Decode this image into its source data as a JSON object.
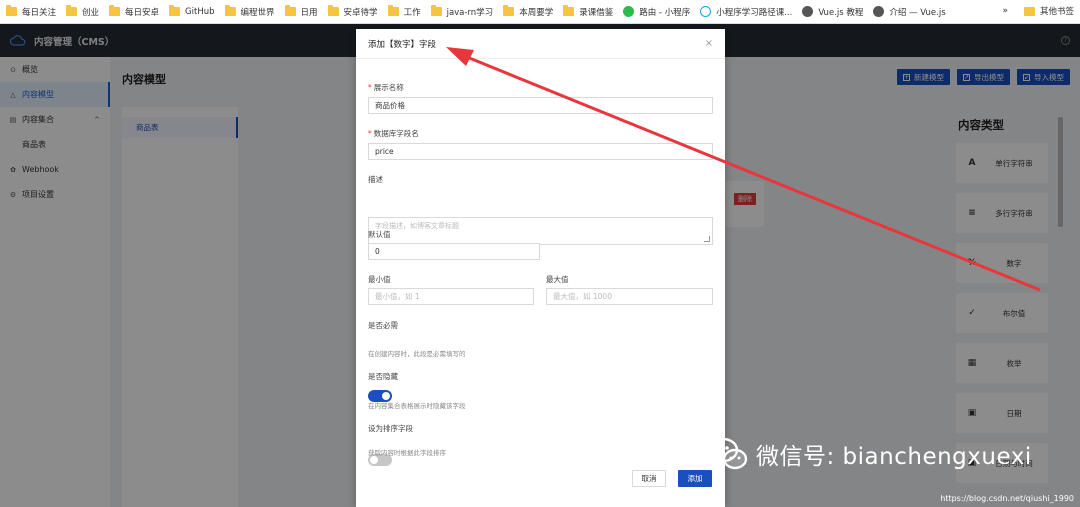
{
  "bookmarks": [
    {
      "label": "每日关注",
      "icon": "folder-icon"
    },
    {
      "label": "创业",
      "icon": "folder-icon"
    },
    {
      "label": "每日安卓",
      "icon": "folder-icon"
    },
    {
      "label": "GitHub",
      "icon": "folder-icon"
    },
    {
      "label": "编程世界",
      "icon": "folder-icon"
    },
    {
      "label": "日用",
      "icon": "folder-icon"
    },
    {
      "label": "安卓待学",
      "icon": "folder-icon"
    },
    {
      "label": "工作",
      "icon": "folder-icon"
    },
    {
      "label": "java-rn学习",
      "icon": "folder-icon"
    },
    {
      "label": "本周要学",
      "icon": "folder-icon"
    },
    {
      "label": "录课借鉴",
      "icon": "folder-icon"
    },
    {
      "label": "路由 - 小程序",
      "icon": "wechat-icon"
    },
    {
      "label": "小程序学习路径课...",
      "icon": "cloud-icon"
    },
    {
      "label": "Vue.js 教程",
      "icon": "globe-icon"
    },
    {
      "label": "介绍 — Vue.js",
      "icon": "globe-icon"
    }
  ],
  "bookmarks_more": "»",
  "bookmarks_other": "其他书签",
  "app": {
    "title": "内容管理（CMS）",
    "help": "?"
  },
  "sidebar": {
    "items": [
      {
        "label": "概览",
        "icon": "⊙"
      },
      {
        "label": "内容模型",
        "icon": "△"
      },
      {
        "label": "内容集合",
        "icon": "▤",
        "caret": "^"
      },
      {
        "label": "商品表",
        "icon": ""
      },
      {
        "label": "Webhook",
        "icon": "✿"
      },
      {
        "label": "项目设置",
        "icon": "⚙"
      }
    ]
  },
  "content": {
    "title": "内容模型",
    "buttons": [
      {
        "label": "新建模型",
        "icon": "+"
      },
      {
        "label": "导出模型",
        "icon": "↗"
      },
      {
        "label": "导入模型",
        "icon": "↙"
      }
    ],
    "schema_item": "商品表",
    "delete_label": "删除"
  },
  "types": {
    "title": "内容类型",
    "items": [
      {
        "label": "单行字符串",
        "icon": "A"
      },
      {
        "label": "多行字符串",
        "icon": "≡"
      },
      {
        "label": "数字",
        "icon": "%"
      },
      {
        "label": "布尔值",
        "icon": "✓"
      },
      {
        "label": "枚举",
        "icon": "▦"
      },
      {
        "label": "日期",
        "icon": "▣"
      },
      {
        "label": "日期与时间",
        "icon": "▣"
      }
    ]
  },
  "modal": {
    "title": "添加【数字】字段",
    "close": "×",
    "fields": {
      "display_name": {
        "label": "展示名称",
        "required": "*",
        "value": "商品价格"
      },
      "db_name": {
        "label": "数据库字段名",
        "required": "*",
        "value": "price"
      },
      "description": {
        "label": "描述",
        "placeholder": "字段描述，如博客文章标题"
      },
      "default": {
        "label": "默认值",
        "value": "0"
      },
      "min": {
        "label": "最小值",
        "placeholder": "最小值，如 1"
      },
      "max": {
        "label": "最大值",
        "placeholder": "最大值，如 1000"
      },
      "required_toggle": {
        "label": "是否必需",
        "hint": "在创建内容时，此段是必需填写的",
        "on": true
      },
      "hidden_toggle": {
        "label": "是否隐藏",
        "hint": "在内容集合表格展示时隐藏该字段",
        "on": false
      },
      "sort_toggle": {
        "label": "设为排序字段",
        "hint": "获取内容时根据此字段排序",
        "on": false
      }
    },
    "cancel": "取消",
    "submit": "添加"
  },
  "watermark": {
    "text": "微信号: bianchengxuexi",
    "source": "https://blog.csdn.net/qiushi_1990"
  },
  "colors": {
    "primary": "#1a4fbf",
    "header_bg": "#262b33",
    "danger": "#e03c3c",
    "annotation": "#e8373c"
  }
}
